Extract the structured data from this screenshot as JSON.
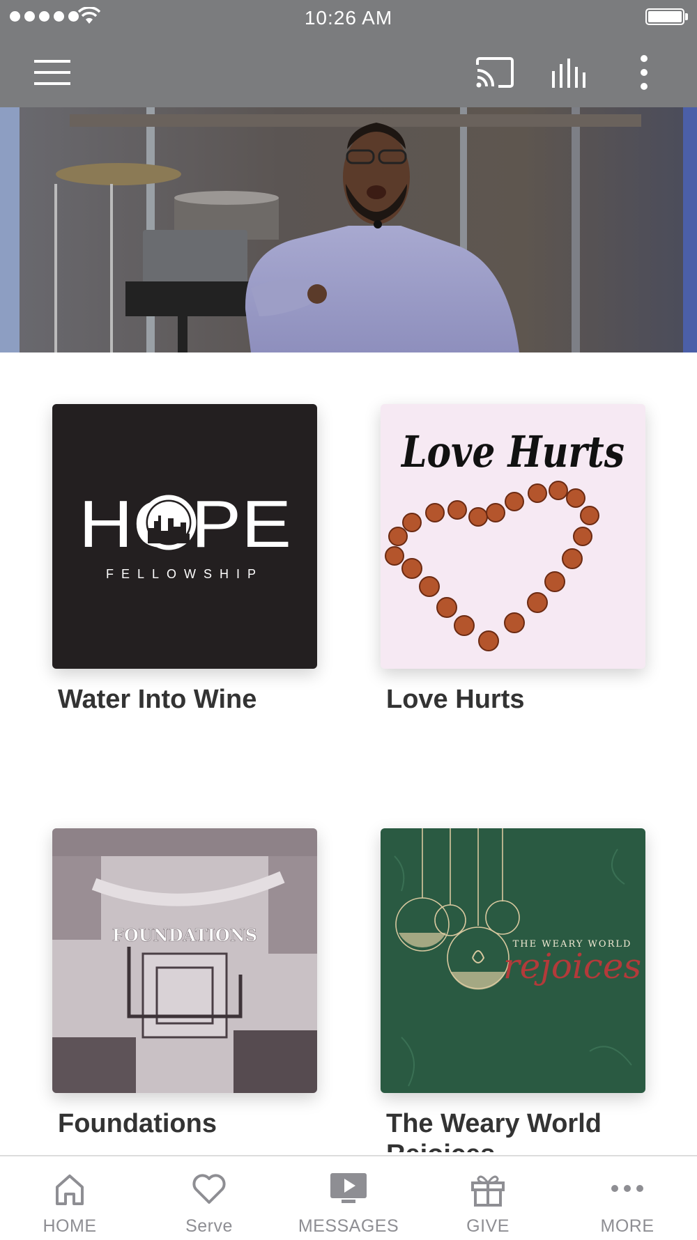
{
  "status_bar": {
    "time": "10:26 AM"
  },
  "app_bar": {
    "menu_icon": "hamburger-menu-icon",
    "cast_icon": "cast-icon",
    "audio_icon": "audio-levels-icon",
    "more_icon": "vertical-ellipsis-icon"
  },
  "series": [
    {
      "title": "Water Into Wine",
      "artwork": {
        "logo_word": "HOPE",
        "logo_sub": "FELLOWSHIP"
      }
    },
    {
      "title": "Love Hurts",
      "artwork": {
        "script": "Love Hurts"
      }
    },
    {
      "title": "Foundations",
      "artwork": {
        "overlay": "FOUNDATIONS"
      }
    },
    {
      "title": "The Weary World Rejoices",
      "artwork": {
        "line1": "THE WEARY WORLD",
        "line2": "rejoices"
      }
    }
  ],
  "tab_bar": {
    "tabs": [
      {
        "label": "HOME",
        "icon": "home-icon"
      },
      {
        "label": "Serve",
        "icon": "heart-icon"
      },
      {
        "label": "MESSAGES",
        "icon": "play-screen-icon"
      },
      {
        "label": "GIVE",
        "icon": "gift-icon"
      },
      {
        "label": "MORE",
        "icon": "more-dots-icon"
      }
    ],
    "active_index": 2
  },
  "colors": {
    "bar_gray": "#7b7c7e",
    "title_text": "#333333",
    "tab_text": "#8e8e93"
  }
}
